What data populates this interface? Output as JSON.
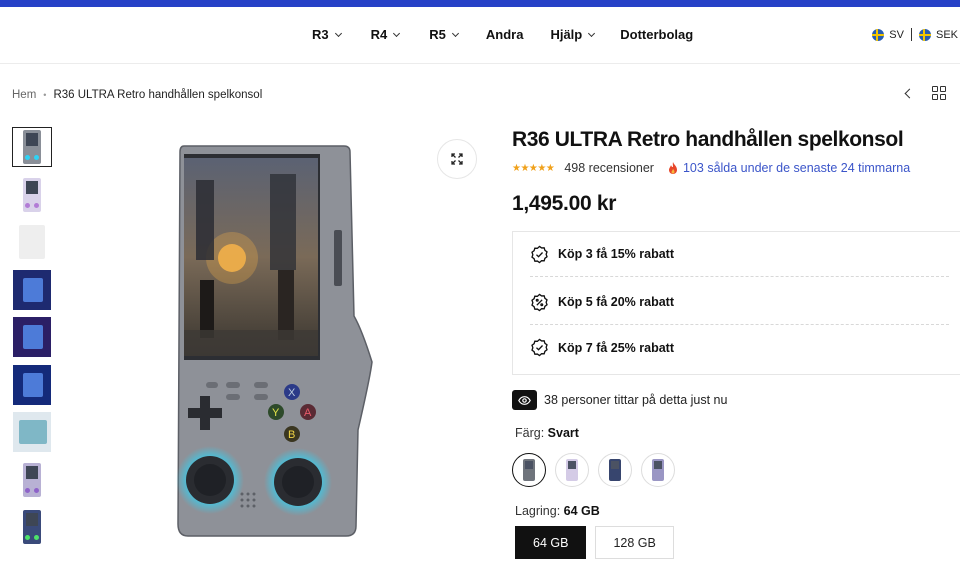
{
  "colors": {
    "brand_bar": "#2741c7",
    "star": "#f0a11b",
    "sold_link": "#3b55c9",
    "glow": "#2ed3f5"
  },
  "nav": {
    "items": [
      {
        "label": "R3",
        "dropdown": true
      },
      {
        "label": "R4",
        "dropdown": true
      },
      {
        "label": "R5",
        "dropdown": true
      },
      {
        "label": "Andra",
        "dropdown": false
      },
      {
        "label": "Hjälp",
        "dropdown": true
      },
      {
        "label": "Dotterbolag",
        "dropdown": false
      }
    ],
    "language": "SV",
    "currency": "SEK"
  },
  "breadcrumb": {
    "home": "Hem",
    "current": "R36 ULTRA Retro handhållen spelkonsol"
  },
  "product": {
    "title": "R36 ULTRA Retro handhållen spelkonsol",
    "rating_stars": 4.5,
    "reviews": "498 recensioner",
    "sold_notice": "103 sålda under de senaste 24 timmarna",
    "price": "1,495.00 kr",
    "offers": [
      {
        "label": "Köp 3 få 15% rabatt",
        "icon": "percent-badge-icon"
      },
      {
        "label": "Köp 5 få 20% rabatt",
        "icon": "percent-badge-icon"
      },
      {
        "label": "Köp 7 få 25% rabatt",
        "icon": "percent-badge-icon"
      }
    ],
    "viewers": "38 personer tittar på detta just nu",
    "color_label": "Färg:",
    "color_value": "Svart",
    "storage_label": "Lagring:",
    "storage_value": "64 GB",
    "storage_options": [
      "64 GB",
      "128 GB"
    ],
    "thumbnails": 9
  },
  "stars_text": "★★★★★"
}
